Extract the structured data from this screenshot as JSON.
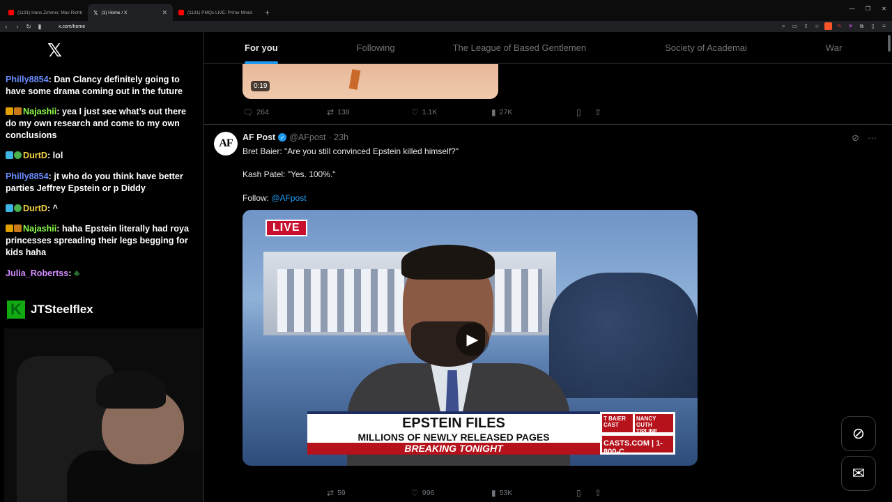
{
  "browser": {
    "tabs": [
      {
        "label": "(1131) Hans Zimmer, Max Richte",
        "icon": "youtube-icon",
        "active": false
      },
      {
        "label": "(1) Home / X",
        "icon": "x-icon",
        "active": true
      },
      {
        "label": "(1131) PMQs LIVE: Prime Ministe",
        "icon": "youtube-icon",
        "active": false
      }
    ],
    "new_tab": "+",
    "url": "x.com/home"
  },
  "chat": {
    "messages": [
      {
        "user": "Philly8854",
        "user_color": "#6a8cff",
        "text": ": Dan Clancy definitely going to have some drama coming out in the future"
      },
      {
        "user": "Najashii",
        "user_color": "#8cff4a",
        "text": ": yea I just see what’s out there do my own research and come to my own conclusions"
      },
      {
        "user": "DurtD",
        "user_color": "#f5d142",
        "text": ": lol"
      },
      {
        "user": "Philly8854",
        "user_color": "#6a8cff",
        "text": ": jt who do you think have better parties Jeffrey Epstein or p Diddy"
      },
      {
        "user": "DurtD",
        "user_color": "#f5d142",
        "text": ": ^"
      },
      {
        "user": "Najashii",
        "user_color": "#8cff4a",
        "text": ": haha Epstein literally had roya princesses spreading their legs begging for kids haha"
      },
      {
        "user": "Julia_Robertss",
        "user_color": "#d28cff",
        "text": ":"
      }
    ],
    "channel_name": "JTSteelflex"
  },
  "x": {
    "nav_tabs": [
      "For you",
      "Following",
      "The League of Based Gentlemen",
      "Society of Academai",
      "War"
    ],
    "prev_post": {
      "duration": "0:19",
      "replies": "264",
      "reposts": "138",
      "likes": "1.1K",
      "views": "27K"
    },
    "post": {
      "avatar_text": "AF",
      "name": "AF Post",
      "handle": "@AFpost",
      "time": "· 23h",
      "line1": "Bret Baier: \"Are you still convinced Epstein killed himself?\"",
      "line2": "Kash Patel: \"Yes. 100%.\"",
      "line3_prefix": "Follow: ",
      "line3_link": "@AFpost",
      "video": {
        "live_label": "LIVE",
        "headline": "EPSTEIN FILES",
        "subline": "MILLIONS OF NEWLY RELEASED PAGES",
        "banner": "BREAKING TONIGHT",
        "side_left": "T BAIER CAST",
        "side_right": "NANCY GUTH TIPLINE",
        "side_bottom": "CASTS.COM | 1-800-C"
      },
      "reposts": "59",
      "likes": "996",
      "views": "53K"
    }
  },
  "colors": {
    "accent": "#1d9bf0"
  }
}
